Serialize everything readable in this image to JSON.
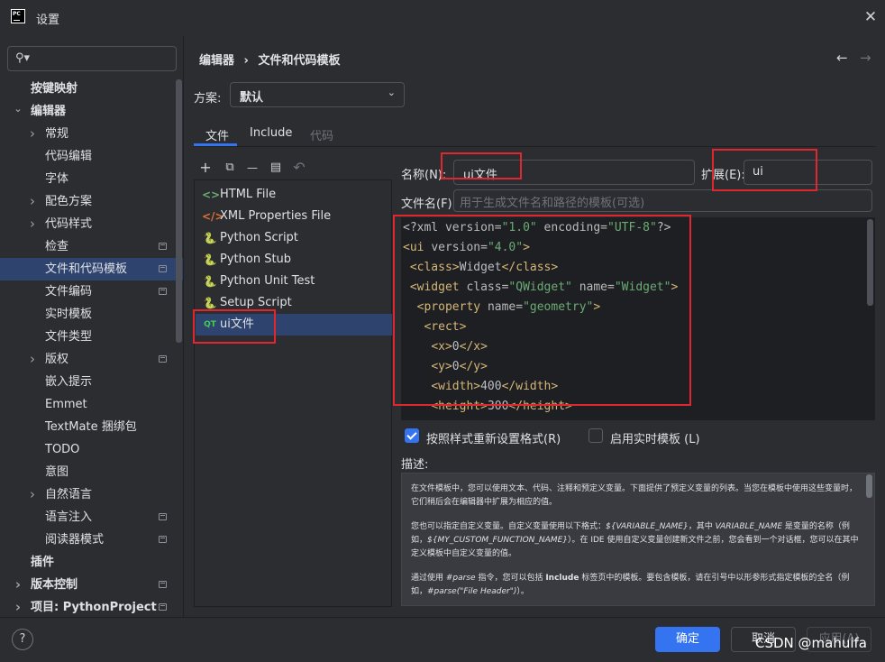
{
  "window": {
    "title": "设置",
    "logo_text": "PC"
  },
  "search": {
    "placeholder": ""
  },
  "sidebar": {
    "items": [
      {
        "label": "按键映射",
        "level": 0,
        "bold": true,
        "chevron": ""
      },
      {
        "label": "编辑器",
        "level": 0,
        "bold": true,
        "chevron": "v"
      },
      {
        "label": "常规",
        "level": 1,
        "chevron": ">"
      },
      {
        "label": "代码编辑",
        "level": 1,
        "chevron": ""
      },
      {
        "label": "字体",
        "level": 1,
        "chevron": ""
      },
      {
        "label": "配色方案",
        "level": 1,
        "chevron": ">"
      },
      {
        "label": "代码样式",
        "level": 1,
        "chevron": ">"
      },
      {
        "label": "检查",
        "level": 1,
        "chevron": "",
        "project": true
      },
      {
        "label": "文件和代码模板",
        "level": 1,
        "chevron": "",
        "selected": true,
        "project": true
      },
      {
        "label": "文件编码",
        "level": 1,
        "chevron": "",
        "project": true
      },
      {
        "label": "实时模板",
        "level": 1,
        "chevron": ""
      },
      {
        "label": "文件类型",
        "level": 1,
        "chevron": ""
      },
      {
        "label": "版权",
        "level": 1,
        "chevron": ">",
        "project": true
      },
      {
        "label": "嵌入提示",
        "level": 1,
        "chevron": ""
      },
      {
        "label": "Emmet",
        "level": 1,
        "chevron": ""
      },
      {
        "label": "TextMate 捆绑包",
        "level": 1,
        "chevron": ""
      },
      {
        "label": "TODO",
        "level": 1,
        "chevron": ""
      },
      {
        "label": "意图",
        "level": 1,
        "chevron": ""
      },
      {
        "label": "自然语言",
        "level": 1,
        "chevron": ">"
      },
      {
        "label": "语言注入",
        "level": 1,
        "chevron": "",
        "project": true
      },
      {
        "label": "阅读器模式",
        "level": 1,
        "chevron": "",
        "project": true
      },
      {
        "label": "插件",
        "level": 0,
        "bold": true,
        "chevron": ""
      },
      {
        "label": "版本控制",
        "level": 0,
        "bold": true,
        "chevron": ">",
        "project": true
      },
      {
        "label": "项目: PythonProject",
        "level": 0,
        "bold": true,
        "chevron": ">",
        "project": true
      }
    ]
  },
  "breadcrumb": {
    "parent": "编辑器",
    "separator": "›",
    "current": "文件和代码模板"
  },
  "nav": {
    "back": "←",
    "forward": "→"
  },
  "scheme": {
    "label": "方案:",
    "value": "默认"
  },
  "tabs": [
    {
      "label": "文件",
      "active": true
    },
    {
      "label": "Include",
      "active": false
    },
    {
      "label": "代码",
      "active": false,
      "disabled": true
    }
  ],
  "toolbar": {
    "add": "+",
    "copy": "⧉",
    "remove": "—",
    "duplicate": "▤",
    "reset": "↶"
  },
  "templates": [
    {
      "label": "HTML File",
      "icon": "html-icon",
      "glyph": "<>",
      "color": "#6aab73"
    },
    {
      "label": "XML Properties File",
      "icon": "xml-icon",
      "glyph": "</>",
      "color": "#e0703a"
    },
    {
      "label": "Python Script",
      "icon": "python-icon",
      "glyph": "🐍",
      "color": "#f2c94c"
    },
    {
      "label": "Python Stub",
      "icon": "python-icon",
      "glyph": "🐍",
      "color": "#f2c94c"
    },
    {
      "label": "Python Unit Test",
      "icon": "python-icon",
      "glyph": "🐍",
      "color": "#f2c94c"
    },
    {
      "label": "Setup Script",
      "icon": "python-icon",
      "glyph": "🐍",
      "color": "#f2c94c"
    },
    {
      "label": "ui文件",
      "icon": "qt-icon",
      "glyph": "QT",
      "color": "#41cd52",
      "selected": true
    }
  ],
  "form": {
    "name_label": "名称(N):",
    "name_value": "ui文件",
    "ext_label": "扩展(E):",
    "ext_value": "ui",
    "filename_label": "文件名(F):",
    "filename_placeholder": "用于生成文件名和路径的模板(可选)"
  },
  "code_lines": [
    [
      [
        "c-pi",
        "<?xml "
      ],
      [
        "c-attr",
        "version="
      ],
      [
        "c-str",
        "\"1.0\""
      ],
      [
        "c-attr",
        " encoding="
      ],
      [
        "c-str",
        "\"UTF-8\""
      ],
      [
        "c-pi",
        "?>"
      ]
    ],
    [
      [
        "c-tag",
        "<ui "
      ],
      [
        "c-attr",
        "version="
      ],
      [
        "c-str",
        "\"4.0\""
      ],
      [
        "c-tag",
        ">"
      ]
    ],
    [
      [
        "c-txt",
        " "
      ],
      [
        "c-tag",
        "<class>"
      ],
      [
        "c-txt",
        "Widget"
      ],
      [
        "c-tag",
        "</class>"
      ]
    ],
    [
      [
        "c-txt",
        " "
      ],
      [
        "c-tag",
        "<widget "
      ],
      [
        "c-attr",
        "class="
      ],
      [
        "c-str",
        "\"QWidget\""
      ],
      [
        "c-attr",
        " name="
      ],
      [
        "c-str",
        "\"Widget\""
      ],
      [
        "c-tag",
        ">"
      ]
    ],
    [
      [
        "c-txt",
        "  "
      ],
      [
        "c-tag",
        "<property "
      ],
      [
        "c-attr",
        "name="
      ],
      [
        "c-str",
        "\"geometry\""
      ],
      [
        "c-tag",
        ">"
      ]
    ],
    [
      [
        "c-txt",
        "   "
      ],
      [
        "c-tag",
        "<rect>"
      ]
    ],
    [
      [
        "c-txt",
        "    "
      ],
      [
        "c-tag",
        "<x>"
      ],
      [
        "c-txt",
        "0"
      ],
      [
        "c-tag",
        "</x>"
      ]
    ],
    [
      [
        "c-txt",
        "    "
      ],
      [
        "c-tag",
        "<y>"
      ],
      [
        "c-txt",
        "0"
      ],
      [
        "c-tag",
        "</y>"
      ]
    ],
    [
      [
        "c-txt",
        "    "
      ],
      [
        "c-tag",
        "<width>"
      ],
      [
        "c-txt",
        "400"
      ],
      [
        "c-tag",
        "</width>"
      ]
    ],
    [
      [
        "c-txt",
        "    "
      ],
      [
        "c-tag",
        "<height>"
      ],
      [
        "c-txt",
        "300"
      ],
      [
        "c-tag",
        "</height>"
      ]
    ]
  ],
  "options": {
    "reformat_label": "按照样式重新设置格式(R)",
    "reformat_checked": true,
    "live_label": "启用实时模板 (L)",
    "live_checked": false
  },
  "description": {
    "label": "描述:",
    "p1": "在文件模板中，您可以使用文本、代码、注释和预定义变量。下面提供了预定义变量的列表。当您在模板中使用这些变量时，它们稍后会在编辑器中扩展为相应的值。",
    "p2a": "您也可以指定自定义变量。自定义变量使用以下格式：",
    "p2b": "${VARIABLE_NAME}",
    "p2c": "，其中 ",
    "p2d": "VARIABLE_NAME",
    "p2e": " 是变量的名称（例如，",
    "p2f": "${MY_CUSTOM_FUNCTION_NAME}",
    "p2g": "）。在 IDE 使用自定义变量创建新文件之前，您会看到一个对话框，您可以在其中定义模板中自定义变量的值。",
    "p3a": "通过使用 ",
    "p3b": "#parse",
    "p3c": " 指令，您可以包括 ",
    "p3d": "Include",
    "p3e": " 标签页中的模板。要包含模板，请在引号中以形参形式指定模板的全名（例如，",
    "p3f": "#parse(\"File Header\")",
    "p3g": "）。"
  },
  "footer": {
    "help": "?",
    "ok": "确定",
    "cancel": "取消",
    "apply": "应用(A)",
    "watermark": "CSDN @mahuifa"
  },
  "colors": {
    "accent": "#3574f0",
    "selection": "#2e436e",
    "highlight": "#e0262e"
  }
}
